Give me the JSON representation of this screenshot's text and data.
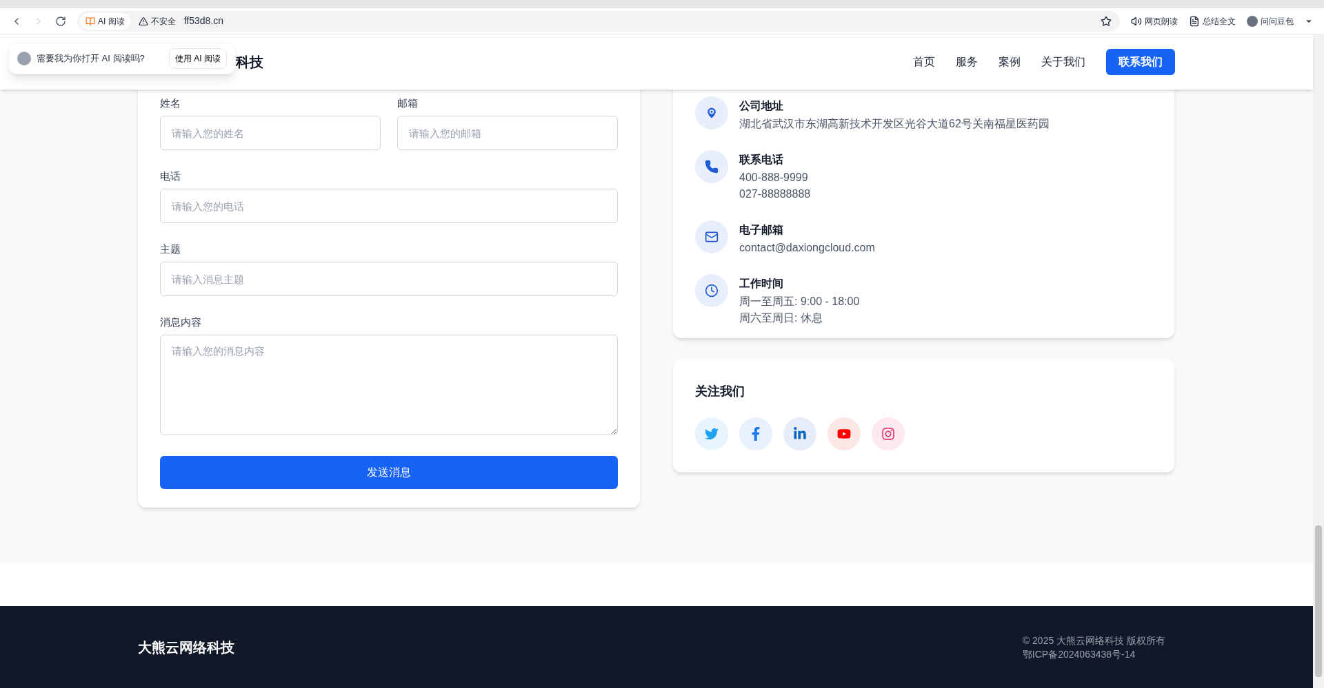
{
  "browser": {
    "ai_read_chip": "AI 阅读",
    "security": "不安全",
    "url": "ff53d8.cn",
    "tools": [
      {
        "kind": "speaker",
        "label": "网页朗读"
      },
      {
        "kind": "summary",
        "label": "总结全文"
      },
      {
        "kind": "avatar",
        "label": "问问豆包"
      }
    ]
  },
  "ai_popup": {
    "question": "需要我为你打开 AI 阅读吗?",
    "button": "使用 AI 阅读"
  },
  "header": {
    "logo": "科技",
    "nav": [
      "首页",
      "服务",
      "案例",
      "关于我们"
    ],
    "cta": "联系我们"
  },
  "form": {
    "fields": [
      {
        "kind": "input",
        "label": "姓名",
        "placeholder": "请输入您的姓名"
      },
      {
        "kind": "input",
        "label": "邮箱",
        "placeholder": "请输入您的邮箱"
      },
      {
        "kind": "input",
        "label": "电话",
        "placeholder": "请输入您的电话"
      },
      {
        "kind": "input",
        "label": "主题",
        "placeholder": "请输入消息主题"
      },
      {
        "kind": "textarea",
        "label": "消息内容",
        "placeholder": "请输入您的消息内容"
      }
    ],
    "submit": "发送消息"
  },
  "contact_items": [
    {
      "kind": "location",
      "title": "公司地址",
      "lines": [
        "湖北省武汉市东湖高新技术开发区光谷大道62号关南福星医药园"
      ]
    },
    {
      "kind": "phone",
      "title": "联系电话",
      "lines": [
        "400-888-9999",
        "027-88888888"
      ]
    },
    {
      "kind": "email",
      "title": "电子邮箱",
      "lines": [
        "contact@daxiongcloud.com"
      ]
    },
    {
      "kind": "clock",
      "title": "工作时间",
      "lines": [
        "周一至周五: 9:00 - 18:00",
        "周六至周日: 休息"
      ]
    }
  ],
  "follow": {
    "title": "关注我们",
    "socials": [
      {
        "kind": "twitter",
        "color": "#1da1f2"
      },
      {
        "kind": "facebook",
        "color": "#1877f2"
      },
      {
        "kind": "linkedin",
        "color": "#0a66c2"
      },
      {
        "kind": "youtube",
        "color": "#ff0000"
      },
      {
        "kind": "instagram",
        "color": "#e1306c"
      }
    ]
  },
  "footer": {
    "logo": "大熊云网络科技",
    "copyright": "© 2025 大熊云网络科技 版权所有",
    "icp": "鄂ICP备2024063438号-14"
  }
}
